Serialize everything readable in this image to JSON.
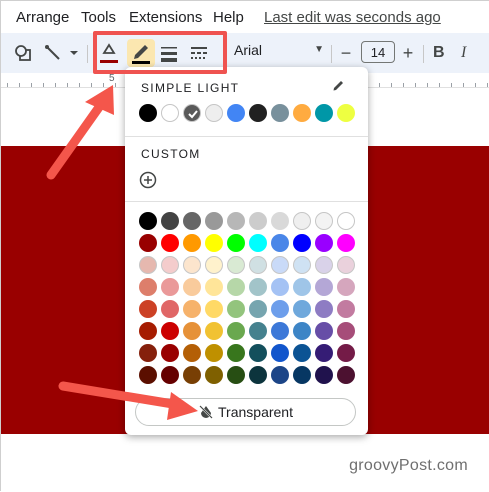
{
  "menubar": {
    "items": [
      "Arrange",
      "Tools",
      "Extensions",
      "Help"
    ],
    "last_edit": "Last edit was seconds ago"
  },
  "toolbar": {
    "icons": [
      "shape-icon",
      "line-icon",
      "fill-color-icon",
      "border-color-icon",
      "border-weight-icon",
      "border-dash-icon"
    ],
    "font": "Arial",
    "font_size": "14",
    "minus_label": "−",
    "plus_label": "+",
    "bold_label": "B",
    "italic_label": "I"
  },
  "ruler": {
    "number": "5"
  },
  "palette": {
    "simple_light_title": "SIMPLE LIGHT",
    "simple_light": [
      "#000000",
      "#ffffff",
      "#595959",
      "#eeeeee",
      "#4285f4",
      "#212121",
      "#78909c",
      "#ffab40",
      "#0097a7",
      "#eeff41"
    ],
    "selected_index": 2,
    "custom_title": "CUSTOM",
    "grid": [
      [
        "#000000",
        "#434343",
        "#666666",
        "#999999",
        "#b7b7b7",
        "#cccccc",
        "#d9d9d9",
        "#efefef",
        "#f3f3f3",
        "#ffffff"
      ],
      [
        "#980000",
        "#ff0000",
        "#ff9900",
        "#ffff00",
        "#00ff00",
        "#00ffff",
        "#4a86e8",
        "#0000ff",
        "#9900ff",
        "#ff00ff"
      ],
      [
        "#e6b8af",
        "#f4cccc",
        "#fce5cd",
        "#fff2cc",
        "#d9ead3",
        "#d0e0e3",
        "#c9daf8",
        "#cfe2f3",
        "#d9d2e9",
        "#ead1dc"
      ],
      [
        "#dd7e6b",
        "#ea9999",
        "#f9cb9c",
        "#ffe599",
        "#b6d7a8",
        "#a2c4c9",
        "#a4c2f4",
        "#9fc5e8",
        "#b4a7d6",
        "#d5a6bd"
      ],
      [
        "#cc4125",
        "#e06666",
        "#f6b26b",
        "#ffd966",
        "#93c47d",
        "#76a5af",
        "#6d9eeb",
        "#6fa8dc",
        "#8e7cc3",
        "#c27ba0"
      ],
      [
        "#a61c00",
        "#cc0000",
        "#e69138",
        "#f1c232",
        "#6aa84f",
        "#45818e",
        "#3c78d8",
        "#3d85c6",
        "#674ea7",
        "#a64d79"
      ],
      [
        "#85200c",
        "#990000",
        "#b45f06",
        "#bf9000",
        "#38761d",
        "#134f5c",
        "#1155cc",
        "#0b5394",
        "#351c75",
        "#741b47"
      ],
      [
        "#5b0f00",
        "#660000",
        "#783f04",
        "#7f6000",
        "#274e13",
        "#0c343d",
        "#1c4587",
        "#073763",
        "#20124d",
        "#4c1130"
      ]
    ],
    "transparent_label": "Transparent"
  },
  "canvas": {
    "shape_color": "#990000"
  },
  "watermark": "groovyPost.com",
  "colors": {
    "highlight": "#ef5350",
    "arrow": "#f4564b"
  }
}
